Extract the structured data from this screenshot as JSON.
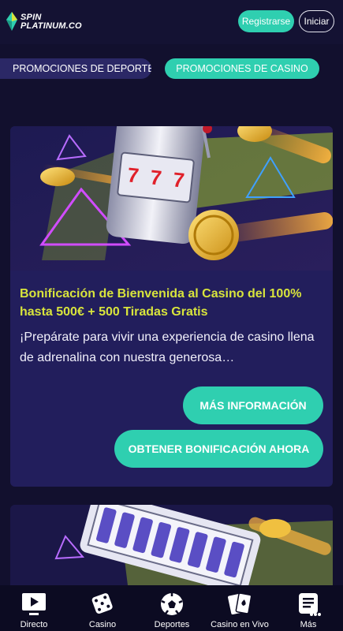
{
  "header": {
    "logo_line1": "SPIN",
    "logo_line2": "PLATINUM.CO",
    "register_label": "Registrarse",
    "login_label": "Iniciar"
  },
  "tabs": [
    {
      "label": "PROMOCIONES DE DEPORTE",
      "active": false
    },
    {
      "label": "PROMOCIONES DE CASINO",
      "active": true
    }
  ],
  "promo": {
    "hero_reels": [
      "7",
      "7",
      "7"
    ],
    "title": "Bonificación de Bienvenida al Casino del 100% hasta 500€ + 500 Tiradas Gratis",
    "description": "¡Prepárate para vivir una experiencia de casino llena de adrenalina con nuestra generosa…",
    "more_info_label": "MÁS INFORMACIÓN",
    "claim_label": "OBTENER BONIFICACIÓN AHORA"
  },
  "bottom_nav": [
    {
      "label": "Directo",
      "icon": "tv-play-icon"
    },
    {
      "label": "Casino",
      "icon": "dice-icon"
    },
    {
      "label": "Deportes",
      "icon": "soccer-ball-icon"
    },
    {
      "label": "Casino en Vivo",
      "icon": "playing-cards-icon"
    },
    {
      "label": "Más",
      "icon": "more-menu-icon"
    }
  ],
  "colors": {
    "background": "#12102e",
    "accent": "#2fcfb0",
    "card": "#221e5c",
    "title": "#d8e43c"
  }
}
